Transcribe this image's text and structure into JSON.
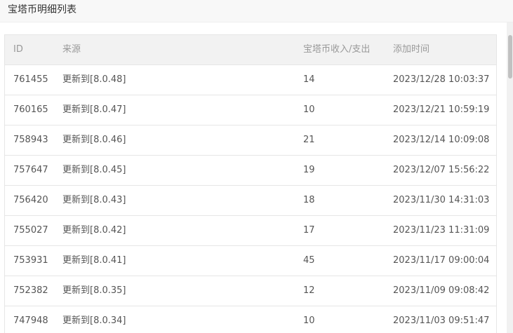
{
  "dialog": {
    "title": "宝塔币明细列表"
  },
  "table": {
    "headers": {
      "id": "ID",
      "source": "来源",
      "amount": "宝塔币收入/支出",
      "time": "添加时间"
    },
    "rows": [
      {
        "id": "761455",
        "source": "更新到[8.0.48]",
        "amount": "14",
        "time": "2023/12/28 10:03:37"
      },
      {
        "id": "760165",
        "source": "更新到[8.0.47]",
        "amount": "10",
        "time": "2023/12/21 10:59:19"
      },
      {
        "id": "758943",
        "source": "更新到[8.0.46]",
        "amount": "21",
        "time": "2023/12/14 10:09:08"
      },
      {
        "id": "757647",
        "source": "更新到[8.0.45]",
        "amount": "19",
        "time": "2023/12/07 15:56:22"
      },
      {
        "id": "756420",
        "source": "更新到[8.0.43]",
        "amount": "18",
        "time": "2023/11/30 14:31:03"
      },
      {
        "id": "755027",
        "source": "更新到[8.0.42]",
        "amount": "17",
        "time": "2023/11/23 11:31:09"
      },
      {
        "id": "753931",
        "source": "更新到[8.0.41]",
        "amount": "45",
        "time": "2023/11/17 09:00:04"
      },
      {
        "id": "752382",
        "source": "更新到[8.0.35]",
        "amount": "12",
        "time": "2023/11/09 09:08:42"
      },
      {
        "id": "747948",
        "source": "更新到[8.0.34]",
        "amount": "10",
        "time": "2023/11/03 09:51:47"
      }
    ]
  }
}
